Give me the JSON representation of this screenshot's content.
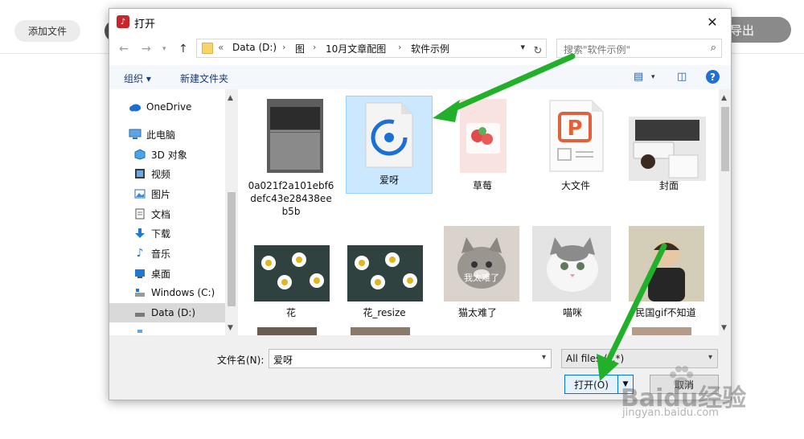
{
  "background_app": {
    "add_button": "添加文件",
    "export_button": "导出"
  },
  "dialog": {
    "title": "打开",
    "address": {
      "overflow": "«",
      "crumbs": [
        "Data (D:)",
        "图",
        "10月文章配图",
        "软件示例"
      ]
    },
    "search_placeholder": "搜索\"软件示例\"",
    "toolbar": {
      "organize": "组织 ▾",
      "new_folder": "新建文件夹"
    },
    "sidebar": [
      {
        "label": "OneDrive",
        "icon": "cloud-icon"
      },
      {
        "label": "此电脑",
        "icon": "computer-icon"
      },
      {
        "label": "3D 对象",
        "icon": "cube-icon"
      },
      {
        "label": "视频",
        "icon": "video-icon"
      },
      {
        "label": "图片",
        "icon": "picture-icon"
      },
      {
        "label": "文档",
        "icon": "document-icon"
      },
      {
        "label": "下载",
        "icon": "download-icon"
      },
      {
        "label": "音乐",
        "icon": "music-icon"
      },
      {
        "label": "桌面",
        "icon": "desktop-icon"
      },
      {
        "label": "Windows (C:)",
        "icon": "drive-icon"
      },
      {
        "label": "Data (D:)",
        "icon": "drive-icon",
        "selected": true
      }
    ],
    "files": [
      {
        "name": "0a021f2a101ebf6defc43e28438eeb5b",
        "kind": "photo-laptop"
      },
      {
        "name": "爱呀",
        "kind": "audio-file",
        "selected": true
      },
      {
        "name": "草莓",
        "kind": "photo-strawberry"
      },
      {
        "name": "大文件",
        "kind": "wps-presentation"
      },
      {
        "name": "封面",
        "kind": "photo-desk"
      },
      {
        "name": "花",
        "kind": "photo-daisies"
      },
      {
        "name": "花_resize",
        "kind": "photo-daisies"
      },
      {
        "name": "猫太难了",
        "kind": "photo-cat-gray"
      },
      {
        "name": "喵咪",
        "kind": "photo-cat-white"
      },
      {
        "name": "民国gif不知道",
        "kind": "photo-child"
      }
    ],
    "cat_caption": "我太难了",
    "filename_label": "文件名(N):",
    "filename_value": "爱呀",
    "filetype_value": "All files (*.*)",
    "open_button": "打开(O)",
    "cancel_button": "取消"
  },
  "watermark": {
    "logo": "Baidu经验",
    "url": "jingyan.baidu.com"
  },
  "colors": {
    "accent": "#0078d7",
    "arrow": "#22b02a",
    "selection": "#cce8ff"
  }
}
